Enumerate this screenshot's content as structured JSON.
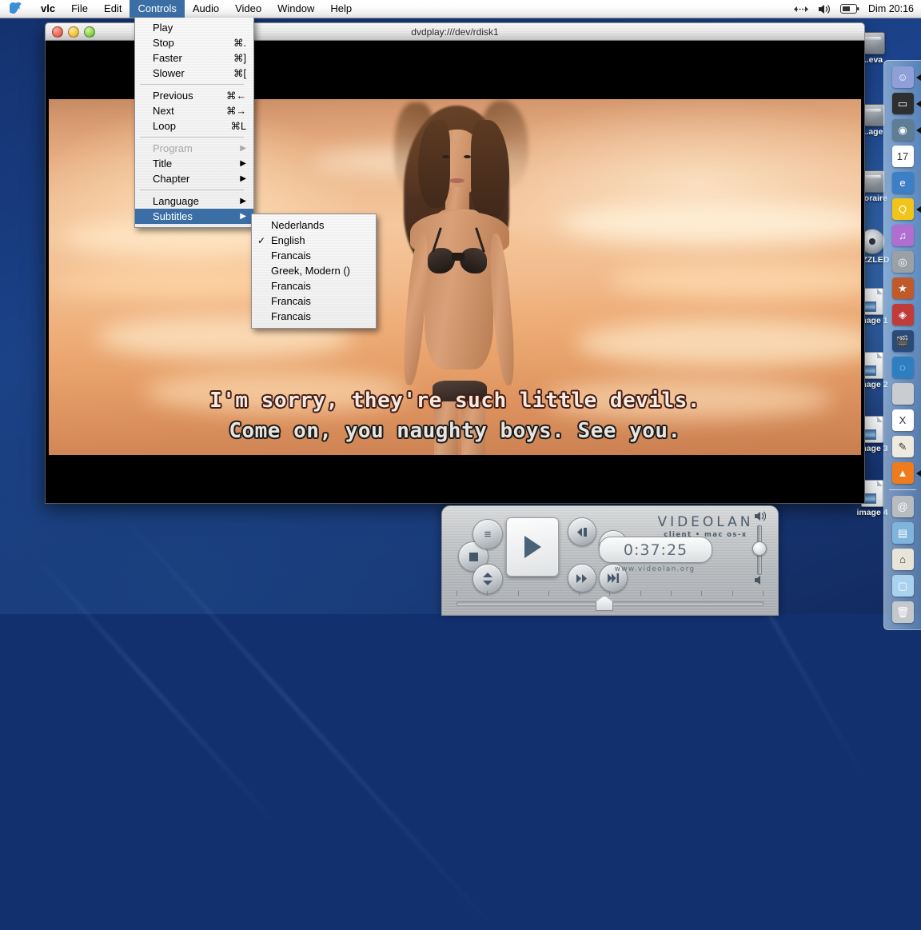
{
  "menubar": {
    "apple_icon": "apple-icon",
    "items": [
      {
        "label": "vlc",
        "active": false,
        "bold": true
      },
      {
        "label": "File",
        "active": false
      },
      {
        "label": "Edit",
        "active": false
      },
      {
        "label": "Controls",
        "active": true
      },
      {
        "label": "Audio",
        "active": false
      },
      {
        "label": "Video",
        "active": false
      },
      {
        "label": "Window",
        "active": false
      },
      {
        "label": "Help",
        "active": false
      }
    ],
    "status": {
      "arrows_icon": "resolution-switch-icon",
      "volume_icon": "volume-icon",
      "battery_icon": "battery-icon",
      "clock": "Dim 20:16"
    }
  },
  "controls_menu": {
    "items": [
      {
        "label": "Play",
        "shortcut": "",
        "type": "item"
      },
      {
        "label": "Stop",
        "shortcut": "⌘.",
        "type": "item"
      },
      {
        "label": "Faster",
        "shortcut": "⌘]",
        "type": "item"
      },
      {
        "label": "Slower",
        "shortcut": "⌘[",
        "type": "item"
      },
      {
        "type": "separator"
      },
      {
        "label": "Previous",
        "shortcut": "⌘←",
        "type": "item"
      },
      {
        "label": "Next",
        "shortcut": "⌘→",
        "type": "item"
      },
      {
        "label": "Loop",
        "shortcut": "⌘L",
        "type": "item"
      },
      {
        "type": "separator"
      },
      {
        "label": "Program",
        "type": "submenu",
        "disabled": true
      },
      {
        "label": "Title",
        "type": "submenu"
      },
      {
        "label": "Chapter",
        "type": "submenu"
      },
      {
        "type": "separator"
      },
      {
        "label": "Language",
        "type": "submenu"
      },
      {
        "label": "Subtitles",
        "type": "submenu",
        "highlighted": true
      }
    ]
  },
  "subtitles_menu": {
    "items": [
      {
        "label": "Nederlands",
        "checked": false
      },
      {
        "label": "English",
        "checked": true
      },
      {
        "label": "Francais",
        "checked": false
      },
      {
        "label": "Greek, Modern ()",
        "checked": false
      },
      {
        "label": "Francais",
        "checked": false
      },
      {
        "label": "Francais",
        "checked": false
      },
      {
        "label": "Francais",
        "checked": false
      }
    ],
    "check_glyph": "✓"
  },
  "video_window": {
    "title": "dvdplay:///dev/rdisk1",
    "traffic_lights": [
      "close-button",
      "minimize-button",
      "zoom-button"
    ],
    "subtitle_line1": "I'm sorry, they're such little devils.",
    "subtitle_line2": "Come on, you naughty boys.  See you."
  },
  "controller": {
    "brand_name": "VIDEOLAN",
    "brand_sub": "client • mac os-x",
    "time": "0:37:25",
    "url": "www.videolan.org",
    "buttons": [
      {
        "name": "playlist-button",
        "glyph": "≡"
      },
      {
        "name": "stop-button",
        "glyph": "■"
      },
      {
        "name": "eject-button",
        "glyph": "⬍"
      },
      {
        "name": "play-button",
        "glyph": "▶"
      },
      {
        "name": "slow-button",
        "glyph": "◀▶"
      },
      {
        "name": "fast-button",
        "glyph": "▶▶"
      },
      {
        "name": "previous-button",
        "glyph": "|◀◀"
      },
      {
        "name": "next-button",
        "glyph": "▶▶|"
      }
    ],
    "volume_max_icon": "speaker-loud-icon",
    "volume_min_icon": "speaker-quiet-icon"
  },
  "desktop": {
    "icons": [
      {
        "label": "...eva",
        "type": "drive"
      },
      {
        "label": "...age",
        "type": "drive"
      },
      {
        "label": "...oraire",
        "type": "drive"
      },
      {
        "label": "...ZZLED",
        "type": "cd"
      },
      {
        "label": "image 1",
        "type": "document"
      },
      {
        "label": "image 2",
        "type": "document"
      },
      {
        "label": "image 3",
        "type": "document"
      },
      {
        "label": "image 4",
        "type": "document"
      }
    ]
  },
  "dock": {
    "items": [
      {
        "name": "finder-icon",
        "label": "Finder",
        "glyph": "☺",
        "bg": "#8f9fd8",
        "running": true
      },
      {
        "name": "terminal-icon",
        "label": "Terminal",
        "glyph": "▭",
        "bg": "#2d2f31",
        "running": true
      },
      {
        "name": "sherlock-icon",
        "label": "Sherlock",
        "glyph": "◉",
        "bg": "#5f7e96",
        "running": true
      },
      {
        "name": "ical-icon",
        "label": "iCal",
        "glyph": "17",
        "bg": "#ffffff",
        "running": false
      },
      {
        "name": "internet-explorer-icon",
        "label": "Internet Explorer",
        "glyph": "e",
        "bg": "#3c7fc4",
        "running": false
      },
      {
        "name": "quicktime-icon",
        "label": "QuickTime",
        "glyph": "Q",
        "bg": "#f0c419",
        "running": true
      },
      {
        "name": "itunes-icon",
        "label": "iTunes",
        "glyph": "♫",
        "bg": "#b06fd0",
        "running": false
      },
      {
        "name": "dvd-player-icon",
        "label": "DVD Player",
        "glyph": "◎",
        "bg": "#9aa0a6",
        "running": false
      },
      {
        "name": "imovie-icon",
        "label": "iMovie",
        "glyph": "★",
        "bg": "#c05a2a",
        "running": false
      },
      {
        "name": "ipicture-icon",
        "label": "Picture",
        "glyph": "◈",
        "bg": "#c23b3b",
        "running": false
      },
      {
        "name": "final-cut-icon",
        "label": "Final Cut",
        "glyph": "🎬",
        "bg": "#2a4a7a",
        "running": false
      },
      {
        "name": "dvd-studio-icon",
        "label": "DVD Studio",
        "glyph": "◌",
        "bg": "#2f7fc0",
        "running": false
      },
      {
        "name": "system-prefs-icon",
        "label": "System Preferences",
        "glyph": "",
        "bg": "#c9ccd0",
        "running": false
      },
      {
        "name": "xcode-icon",
        "label": "X",
        "glyph": "X",
        "bg": "#ffffff",
        "running": false
      },
      {
        "name": "textedit-icon",
        "label": "TextEdit",
        "glyph": "✎",
        "bg": "#eeeae0",
        "running": false
      },
      {
        "name": "vlc-icon",
        "label": "VLC",
        "glyph": "▲",
        "bg": "#ef7b1c",
        "running": true
      },
      {
        "name": "mail-icon",
        "label": "Mail",
        "glyph": "@",
        "bg": "#b8bcc0",
        "running": false
      },
      {
        "name": "documents-folder-icon",
        "label": "Documents",
        "glyph": "▤",
        "bg": "#7fb4dd",
        "running": false
      },
      {
        "name": "home-folder-icon",
        "label": "Home",
        "glyph": "⌂",
        "bg": "#e8e4d8",
        "running": false
      },
      {
        "name": "folder-icon",
        "label": "Folder",
        "glyph": "▢",
        "bg": "#a9d2ef",
        "running": false
      },
      {
        "name": "trash-icon",
        "label": "Trash",
        "glyph": "🗑",
        "bg": "#c4c8cc",
        "running": false
      }
    ]
  }
}
